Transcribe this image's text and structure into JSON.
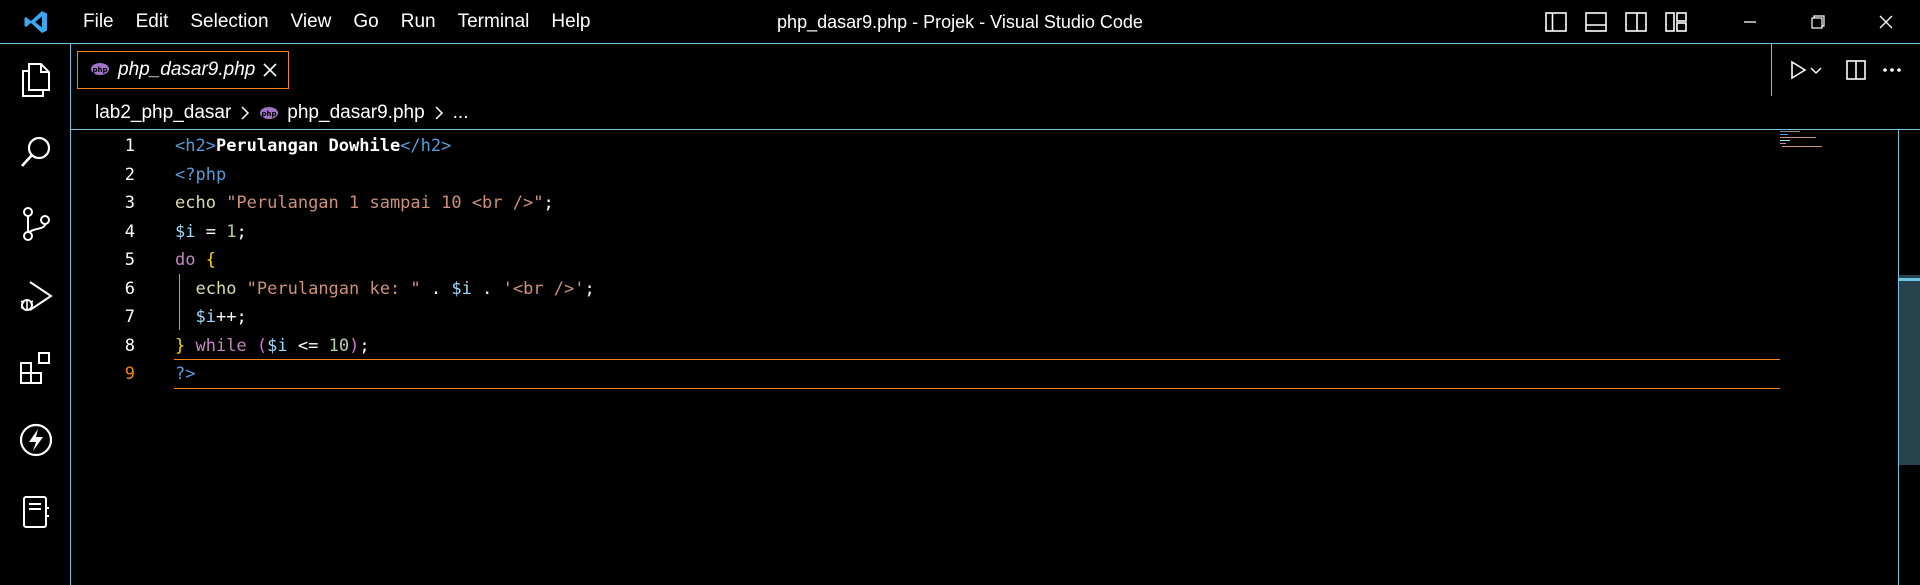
{
  "titlebar": {
    "menu": [
      "File",
      "Edit",
      "Selection",
      "View",
      "Go",
      "Run",
      "Terminal",
      "Help"
    ],
    "window_title": "php_dasar9.php - Projek - Visual Studio Code"
  },
  "tab": {
    "label": "php_dasar9.php"
  },
  "breadcrumb": {
    "folder": "lab2_php_dasar",
    "file": "php_dasar9.php",
    "more": "..."
  },
  "editor": {
    "active_line": 9,
    "lines": [
      {
        "n": "1",
        "tokens": [
          [
            "t-tag",
            "<h2>"
          ],
          [
            "t-bold",
            "Perulangan Dowhile"
          ],
          [
            "t-tag",
            "</h2>"
          ]
        ]
      },
      {
        "n": "2",
        "tokens": [
          [
            "t-php",
            "<?php"
          ]
        ]
      },
      {
        "n": "3",
        "tokens": [
          [
            "t-echo",
            "echo "
          ],
          [
            "t-str",
            "\"Perulangan 1 sampai 10 <br />\""
          ],
          [
            "t-punc",
            ";"
          ]
        ]
      },
      {
        "n": "4",
        "tokens": [
          [
            "t-var",
            "$i"
          ],
          [
            "t-punc",
            " = "
          ],
          [
            "t-num",
            "1"
          ],
          [
            "t-punc",
            ";"
          ]
        ]
      },
      {
        "n": "5",
        "tokens": [
          [
            "t-kw",
            "do "
          ],
          [
            "t-brace",
            "{"
          ]
        ]
      },
      {
        "n": "6",
        "tokens": [
          [
            "t-punc",
            "  "
          ],
          [
            "t-echo",
            "echo "
          ],
          [
            "t-str",
            "\"Perulangan ke: \""
          ],
          [
            "t-punc",
            " . "
          ],
          [
            "t-var",
            "$i"
          ],
          [
            "t-punc",
            " . "
          ],
          [
            "t-str",
            "'<br />'"
          ],
          [
            "t-punc",
            ";"
          ]
        ]
      },
      {
        "n": "7",
        "tokens": [
          [
            "t-punc",
            "  "
          ],
          [
            "t-var",
            "$i"
          ],
          [
            "t-punc",
            "++;"
          ]
        ]
      },
      {
        "n": "8",
        "tokens": [
          [
            "t-brace",
            "}"
          ],
          [
            "t-kw",
            " while "
          ],
          [
            "t-paren",
            "("
          ],
          [
            "t-var",
            "$i"
          ],
          [
            "t-punc",
            " <= "
          ],
          [
            "t-num",
            "10"
          ],
          [
            "t-paren",
            ")"
          ],
          [
            "t-punc",
            ";"
          ]
        ]
      },
      {
        "n": "9",
        "tokens": [
          [
            "t-php",
            "?>"
          ]
        ]
      }
    ]
  },
  "colors": {
    "accent_border": "#6fc3df",
    "active_border": "#f38518",
    "background": "#000000"
  },
  "icons": {
    "activity": [
      "explorer-icon",
      "search-icon",
      "source-control-icon",
      "run-debug-icon",
      "extensions-icon",
      "lightning-icon",
      "notebook-icon"
    ],
    "title_layout": [
      "toggle-primary-sidebar-icon",
      "toggle-panel-icon",
      "toggle-secondary-sidebar-icon",
      "customize-layout-icon"
    ],
    "window": [
      "minimize-icon",
      "restore-icon",
      "close-icon"
    ],
    "editor_actions": [
      "run-icon",
      "chevron-down-icon",
      "split-editor-icon",
      "more-actions-icon"
    ]
  }
}
